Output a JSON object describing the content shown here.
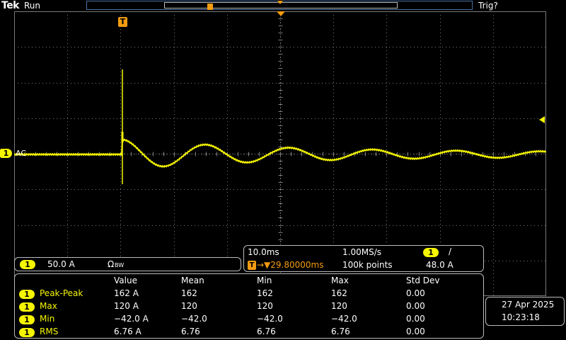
{
  "header": {
    "brand": "Tek",
    "run_state": "Run",
    "trigger_state": "Trig?",
    "trigger_marker": "T"
  },
  "channel": {
    "number": "1",
    "coupling_label": "AC",
    "scale": "50.0 A",
    "impedance": "Ω",
    "bandwidth": "BW",
    "trace_color": "#f5f500"
  },
  "timebase": {
    "time_per_div": "10.0ms",
    "sample_rate": "1.00MS/s",
    "trigger_position": "→▼29.80000ms",
    "record_length": "100k points",
    "trigger_channel": "1",
    "trigger_slope": "/",
    "trigger_level": "48.0 A"
  },
  "measurements": {
    "headers": [
      "Value",
      "Mean",
      "Min",
      "Max",
      "Std Dev"
    ],
    "rows": [
      {
        "channel": "1",
        "name": "Peak-Peak",
        "value": "162 A",
        "mean": "162",
        "min": "162",
        "max": "162",
        "std_dev": "0.00"
      },
      {
        "channel": "1",
        "name": "Max",
        "value": "120 A",
        "mean": "120",
        "min": "120",
        "max": "120",
        "std_dev": "0.00"
      },
      {
        "channel": "1",
        "name": "Min",
        "value": "−42.0 A",
        "mean": "−42.0",
        "min": "−42.0",
        "max": "−42.0",
        "std_dev": "0.00"
      },
      {
        "channel": "1",
        "name": "RMS",
        "value": "6.76 A",
        "mean": "6.76",
        "min": "6.76",
        "max": "6.76",
        "std_dev": "0.00"
      }
    ]
  },
  "datetime": {
    "date": "27 Apr  2025",
    "time": "10:23:18"
  },
  "colors": {
    "background": "#000000",
    "grid": "#7a7a7a",
    "channel1": "#f5f500",
    "trigger": "#f39c12",
    "record_bar": "#4a6fa5"
  }
}
